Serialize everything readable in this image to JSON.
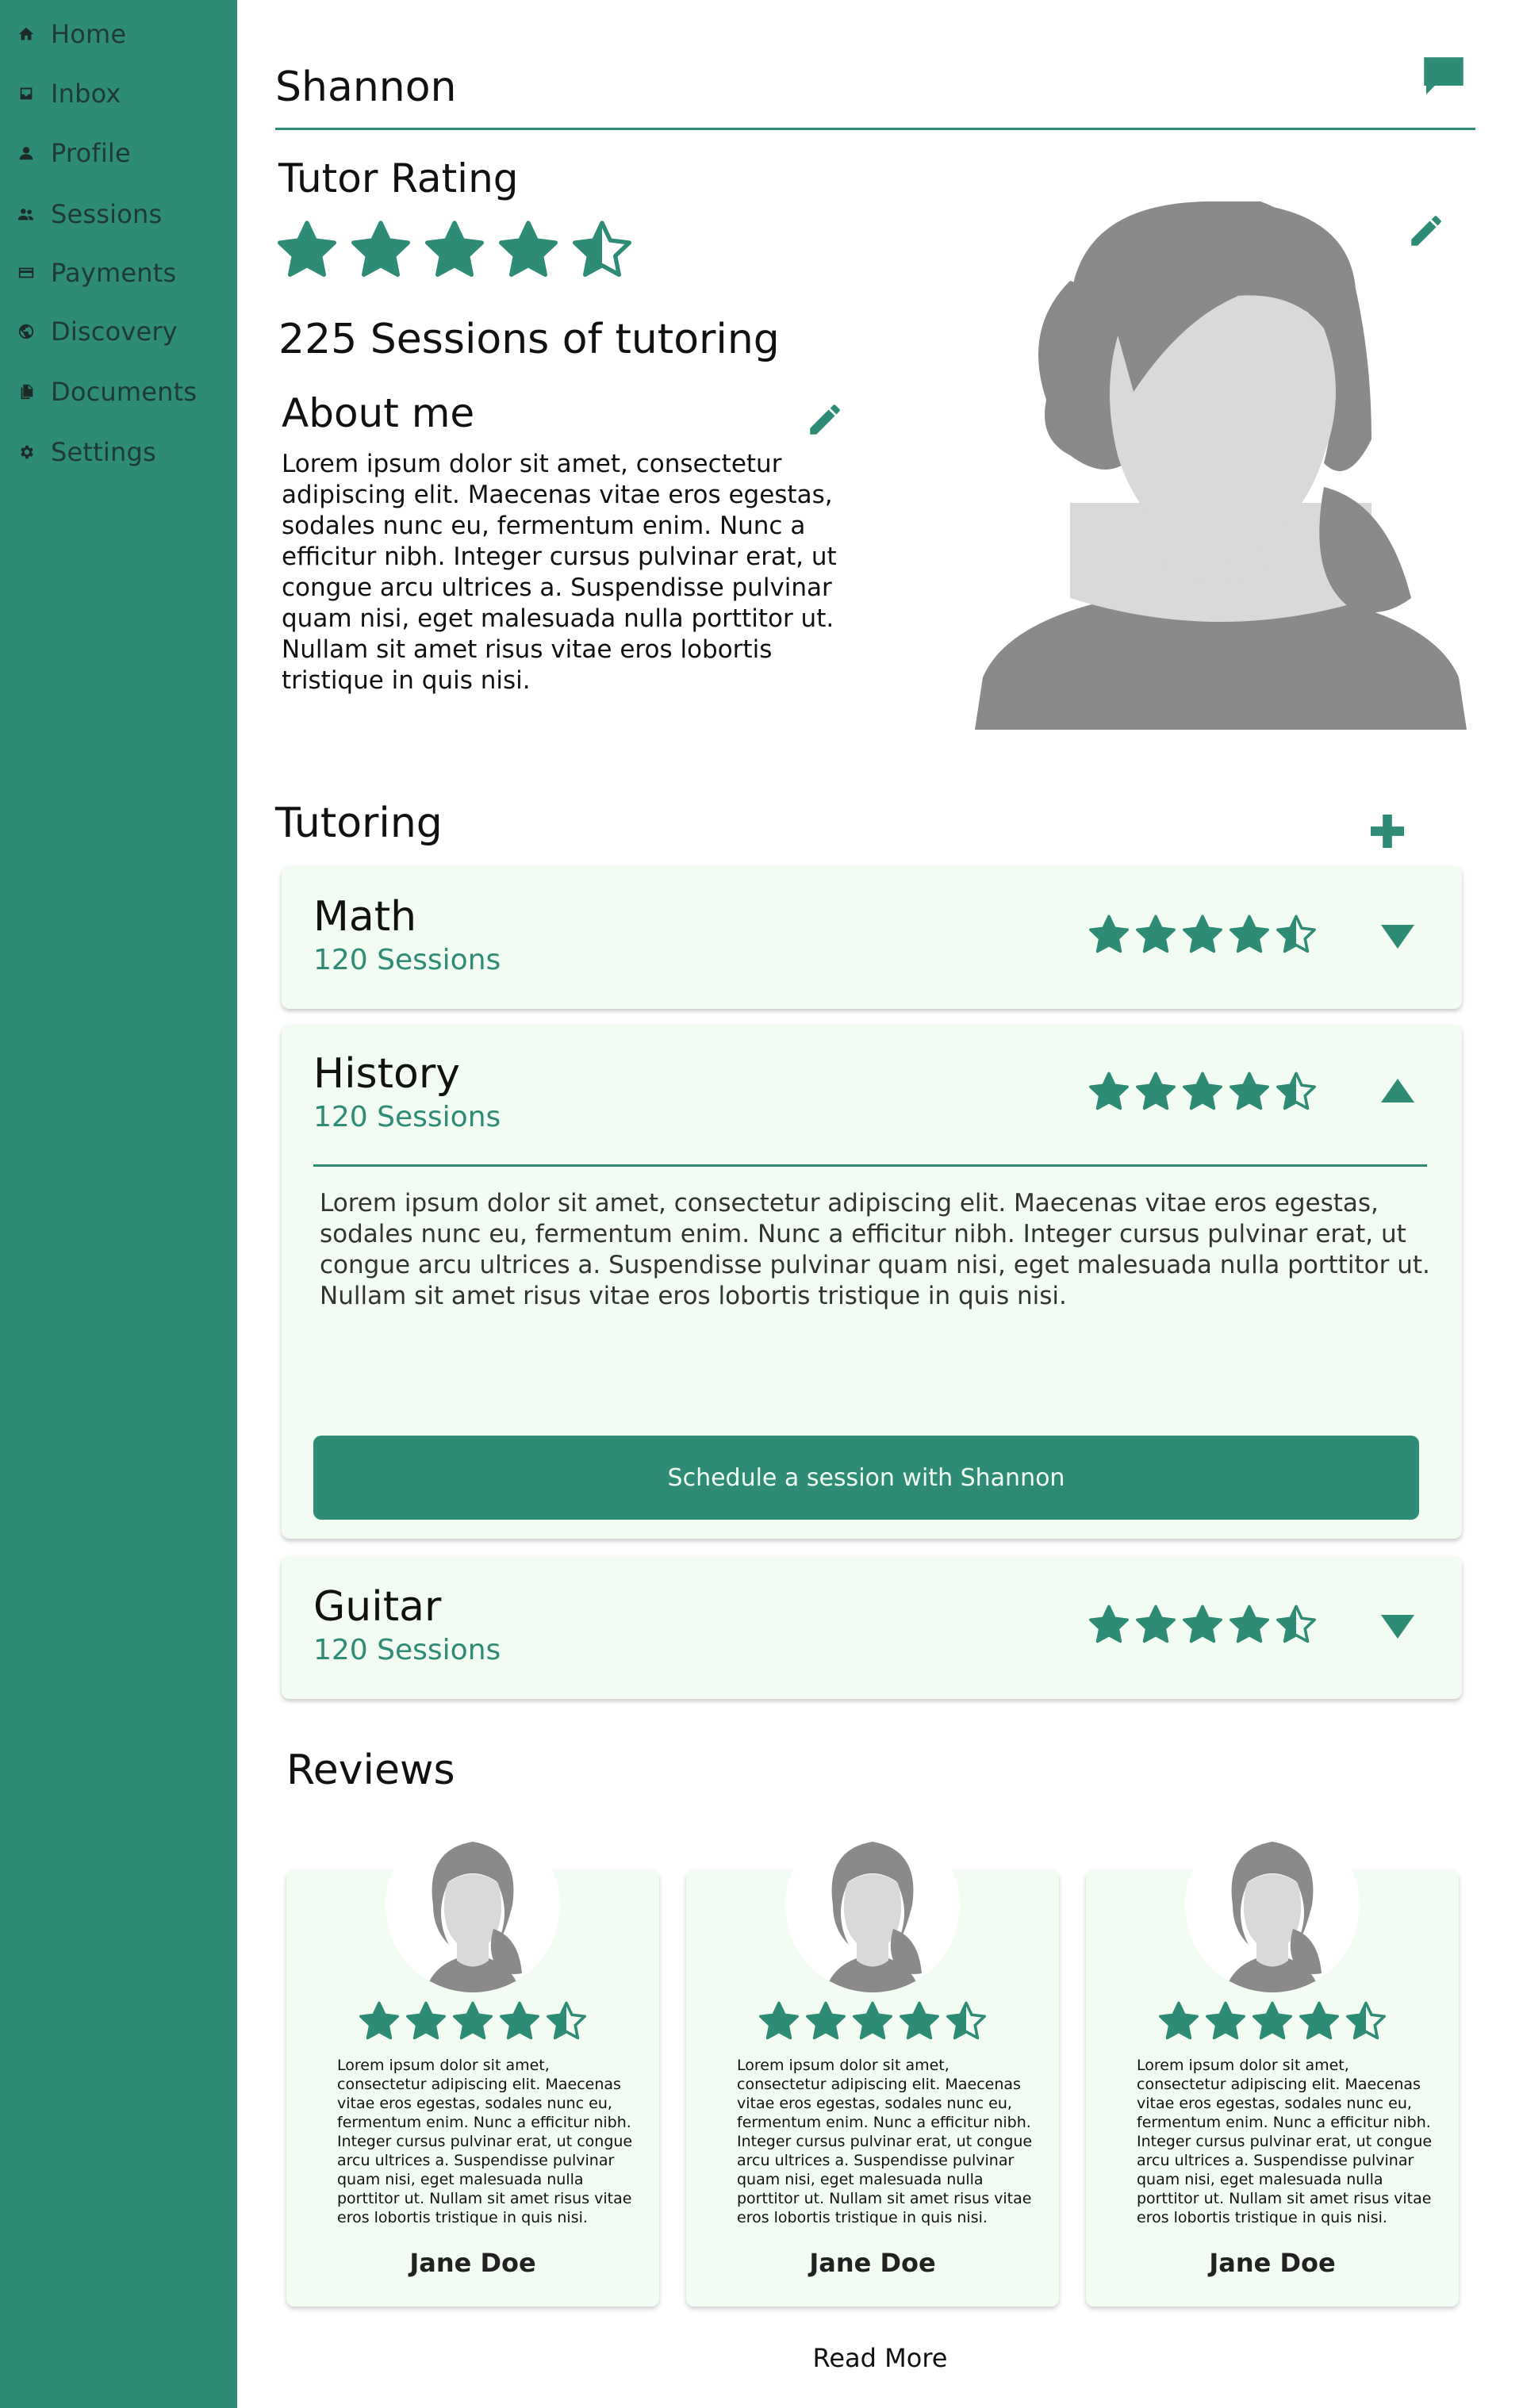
{
  "sidebar": {
    "items": [
      {
        "label": "Home",
        "icon": "home-icon"
      },
      {
        "label": "Inbox",
        "icon": "inbox-icon"
      },
      {
        "label": "Profile",
        "icon": "person-icon"
      },
      {
        "label": "Sessions",
        "icon": "people-icon"
      },
      {
        "label": "Payments",
        "icon": "credit-card-icon"
      },
      {
        "label": "Discovery",
        "icon": "globe-icon"
      },
      {
        "label": "Documents",
        "icon": "documents-icon"
      },
      {
        "label": "Settings",
        "icon": "gear-icon"
      }
    ]
  },
  "header": {
    "name": "Shannon",
    "chat_icon": "chat-icon"
  },
  "profile": {
    "rating_title": "Tutor Rating",
    "rating": 4.5,
    "sessions_text": "225 Sessions of tutoring",
    "about_title": "About me",
    "about_text": "Lorem ipsum dolor sit amet, consectetur adipiscing elit. Maecenas vitae eros egestas, sodales nunc eu, fermentum enim. Nunc a efficitur nibh. Integer cursus pulvinar erat, ut congue arcu ultrices a. Suspendisse pulvinar quam nisi, eget malesuada nulla porttitor ut. Nullam sit amet risus vitae eros lobortis tristique in quis nisi."
  },
  "tutoring": {
    "title": "Tutoring",
    "subjects": [
      {
        "name": "Math",
        "sessions": "120 Sessions",
        "rating": 4.5,
        "expanded": false
      },
      {
        "name": "History",
        "sessions": "120 Sessions",
        "rating": 4.5,
        "expanded": true,
        "description": "Lorem ipsum dolor sit amet, consectetur adipiscing elit. Maecenas vitae eros egestas, sodales nunc eu, fermentum enim. Nunc a efficitur nibh. Integer cursus pulvinar erat, ut congue arcu ultrices a. Suspendisse pulvinar quam nisi, eget malesuada nulla porttitor ut. Nullam sit amet risus vitae eros lobortis tristique in quis nisi.",
        "schedule_label": "Schedule a session with Shannon"
      },
      {
        "name": "Guitar",
        "sessions": "120 Sessions",
        "rating": 4.5,
        "expanded": false
      }
    ]
  },
  "reviews": {
    "title": "Reviews",
    "items": [
      {
        "name": "Jane Doe",
        "rating": 4.5,
        "text": "Lorem ipsum dolor sit amet, consectetur adipiscing elit. Maecenas vitae eros egestas, sodales nunc eu, fermentum enim. Nunc a efficitur nibh. Integer cursus pulvinar erat, ut congue arcu ultrices a. Suspendisse pulvinar quam nisi, eget malesuada nulla porttitor ut. Nullam sit amet risus vitae eros lobortis tristique in quis nisi."
      },
      {
        "name": "Jane Doe",
        "rating": 4.5,
        "text": "Lorem ipsum dolor sit amet, consectetur adipiscing elit. Maecenas vitae eros egestas, sodales nunc eu, fermentum enim. Nunc a efficitur nibh. Integer cursus pulvinar erat, ut congue arcu ultrices a. Suspendisse pulvinar quam nisi, eget malesuada nulla porttitor ut. Nullam sit amet risus vitae eros lobortis tristique in quis nisi."
      },
      {
        "name": "Jane Doe",
        "rating": 4.5,
        "text": "Lorem ipsum dolor sit amet, consectetur adipiscing elit. Maecenas vitae eros egestas, sodales nunc eu, fermentum enim. Nunc a efficitur nibh. Integer cursus pulvinar erat, ut congue arcu ultrices a. Suspendisse pulvinar quam nisi, eget malesuada nulla porttitor ut. Nullam sit amet risus vitae eros lobortis tristique in quis nisi."
      }
    ],
    "read_more": "Read More"
  },
  "colors": {
    "accent": "#2e8b75",
    "card_bg": "#f3fcf2",
    "avatar_gray": "#8a8a8a",
    "face_gray": "#d9d9d9"
  }
}
